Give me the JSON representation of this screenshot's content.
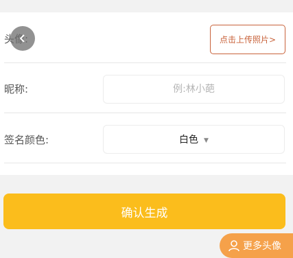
{
  "form": {
    "avatar_label": "头像:",
    "upload_button": "点击上传照片>",
    "nickname_label": "昵称:",
    "nickname_placeholder": "例:林小葩",
    "nickname_value": "",
    "color_label": "签名颜色:",
    "color_selected": "白色",
    "caret": "▼"
  },
  "actions": {
    "confirm_label": "确认生成",
    "more_avatars_label": "更多头像"
  },
  "colors": {
    "confirm_bg": "#fbbd1c",
    "upload_border": "#c8623a",
    "more_bg": "#f5a14a"
  },
  "icons": {
    "back": "chevron-left-icon",
    "more": "person-icon"
  }
}
